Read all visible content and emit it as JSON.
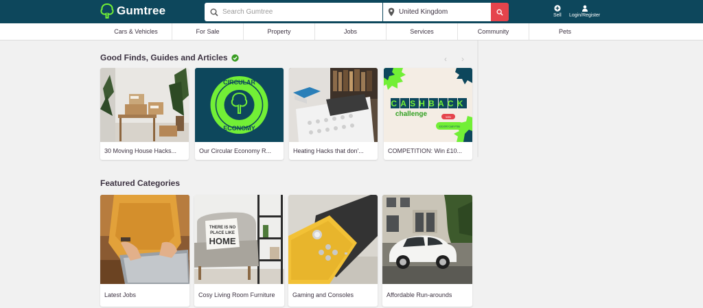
{
  "header": {
    "brand": "Gumtree",
    "search_placeholder": "Search Gumtree",
    "location_value": "United Kingdom",
    "sell_label": "Sell",
    "login_label": "Login/Register",
    "colors": {
      "header_bg": "#0d475c",
      "accent": "#72ef36",
      "search_button": "#e5444c"
    }
  },
  "nav": {
    "items": [
      {
        "label": "Cars & Vehicles"
      },
      {
        "label": "For Sale"
      },
      {
        "label": "Property"
      },
      {
        "label": "Jobs"
      },
      {
        "label": "Services"
      },
      {
        "label": "Community"
      },
      {
        "label": "Pets"
      }
    ]
  },
  "good_finds": {
    "title": "Good Finds, Guides and Articles",
    "cards": [
      {
        "caption": "30 Moving House Hacks..."
      },
      {
        "caption": "Our Circular Economy R..."
      },
      {
        "caption": "Heating Hacks that don'..."
      },
      {
        "caption": "COMPETITION: Win £10..."
      }
    ],
    "circular_text_top": "CIRCULAR",
    "circular_text_bottom": "ECONOMY",
    "cashback_word": "CASHBACK",
    "challenge_word": "challenge",
    "cashback_badge": "WIN",
    "cashback_prize": "£10,000 Cash Prize"
  },
  "featured": {
    "title": "Featured Categories",
    "cards": [
      {
        "caption": "Latest Jobs"
      },
      {
        "caption": "Cosy Living Room Furniture"
      },
      {
        "caption": "Gaming and Consoles"
      },
      {
        "caption": "Affordable Run-arounds"
      }
    ],
    "pillow_text_line1": "THERE IS NO",
    "pillow_text_line2": "PLACE LIKE",
    "pillow_text_line3": "HOME"
  }
}
